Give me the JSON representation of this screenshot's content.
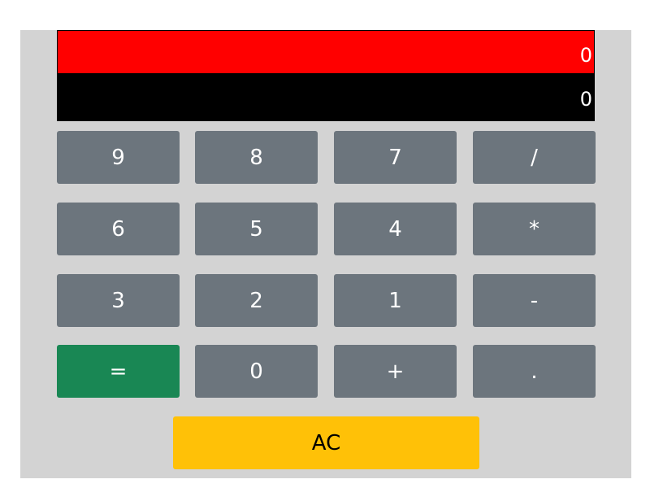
{
  "display": {
    "previous": "0",
    "current": "0"
  },
  "keys": {
    "nine": "9",
    "eight": "8",
    "seven": "7",
    "divide": "/",
    "six": "6",
    "five": "5",
    "four": "4",
    "multiply": "*",
    "three": "3",
    "two": "2",
    "one": "1",
    "subtract": "-",
    "equals": "=",
    "zero": "0",
    "add": "+",
    "decimal": ".",
    "clear": "AC"
  },
  "colors": {
    "previous_display_bg": "#ff0000",
    "current_display_bg": "#000000",
    "digit_key_bg": "#6c757d",
    "equals_key_bg": "#198754",
    "clear_key_bg": "#ffc107",
    "panel_bg": "#d3d3d3"
  }
}
